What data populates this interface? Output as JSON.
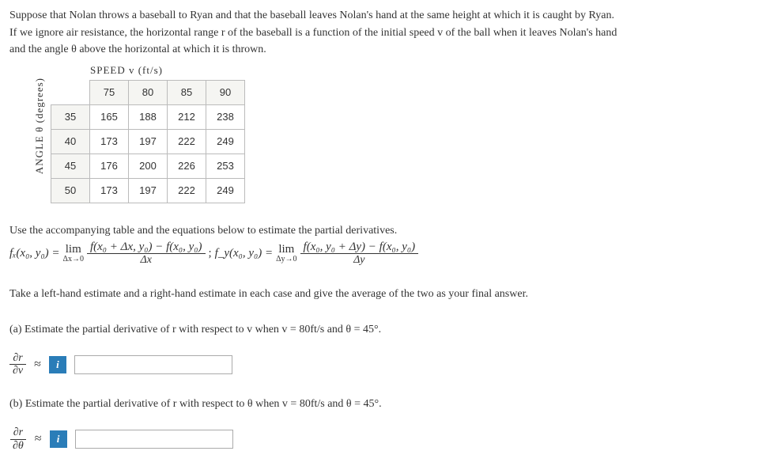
{
  "intro": {
    "p1": "Suppose that Nolan throws a baseball to Ryan and that the baseball leaves Nolan's hand at the same height at which it is caught by Ryan.",
    "p2": "If we ignore air resistance, the horizontal range r of the baseball is a function of the initial speed v of the ball when it leaves Nolan's hand",
    "p3": "and the angle θ above the horizontal at which it is thrown."
  },
  "table": {
    "hlabel": "SPEED v (ft/s)",
    "vlabel": "ANGLE θ (degrees)",
    "col_headers": [
      "75",
      "80",
      "85",
      "90"
    ],
    "row_headers": [
      "35",
      "40",
      "45",
      "50"
    ],
    "cells": [
      [
        "165",
        "188",
        "212",
        "238"
      ],
      [
        "173",
        "197",
        "222",
        "249"
      ],
      [
        "176",
        "200",
        "226",
        "253"
      ],
      [
        "173",
        "197",
        "222",
        "249"
      ]
    ]
  },
  "chart_data": {
    "type": "table",
    "x_variable": "speed v (ft/s)",
    "y_variable": "angle θ (degrees)",
    "value_variable": "range r (ft)",
    "x": [
      75,
      80,
      85,
      90
    ],
    "y": [
      35,
      40,
      45,
      50
    ],
    "values": [
      [
        165,
        188,
        212,
        238
      ],
      [
        173,
        197,
        222,
        249
      ],
      [
        176,
        200,
        226,
        253
      ],
      [
        173,
        197,
        222,
        249
      ]
    ]
  },
  "prompt1": "Use the accompanying table and the equations below to estimate the partial derivatives.",
  "eq": {
    "fx_lhs": "fₓ(x₀, y₀)  =",
    "fx_lim_top": "lim",
    "fx_lim_sub": "Δx→0",
    "fx_num": "f(x₀ + Δx, y₀) − f(x₀, y₀)",
    "fx_den": "Δx",
    "sep": "; ",
    "fy_lhs": "f_y(x₀, y₀)  =",
    "fy_lim_top": "lim",
    "fy_lim_sub": "Δy→0",
    "fy_num": "f(x₀, y₀ + Δy) − f(x₀, y₀)",
    "fy_den": "Δy"
  },
  "prompt2": "Take a left-hand estimate and a right-hand estimate in each case and give the average of the two as your final answer.",
  "partA": {
    "q": "(a) Estimate the partial derivative of r with respect to v when v  =  80ft/s and θ  =  45°.",
    "lhs_num": "∂r",
    "lhs_den": "∂v",
    "approx": "≈",
    "info": "i"
  },
  "partB": {
    "q": "(b) Estimate the partial derivative of r with respect to θ when v  =  80ft/s and θ  =  45°.",
    "lhs_num": "∂r",
    "lhs_den": "∂θ",
    "approx": "≈",
    "info": "i"
  }
}
